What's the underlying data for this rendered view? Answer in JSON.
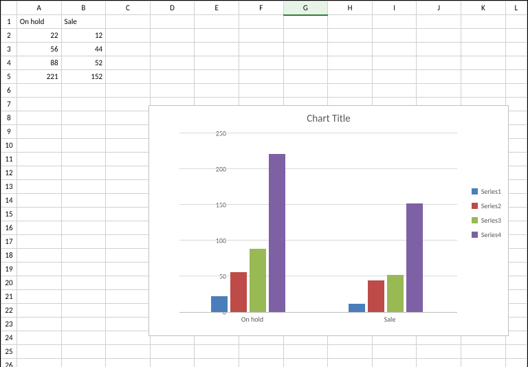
{
  "columns": [
    "A",
    "B",
    "C",
    "D",
    "E",
    "F",
    "G",
    "H",
    "I",
    "J",
    "K",
    "L"
  ],
  "selected_col": "G",
  "rows": 26,
  "sheet": {
    "r1": {
      "A": "On hold",
      "B": "Sale"
    },
    "r2": {
      "A": "22",
      "B": "12"
    },
    "r3": {
      "A": "56",
      "B": "44"
    },
    "r4": {
      "A": "88",
      "B": "52"
    },
    "r5": {
      "A": "221",
      "B": "152"
    }
  },
  "chart_title": "Chart Title",
  "yticks": [
    "0",
    "50",
    "100",
    "150",
    "200",
    "250"
  ],
  "xlabels": {
    "0": "On hold",
    "1": "Sale"
  },
  "legend": {
    "0": "Series1",
    "1": "Series2",
    "2": "Series3",
    "3": "Series4"
  },
  "chart_data": {
    "type": "bar",
    "title": "Chart Title",
    "xlabel": "",
    "ylabel": "",
    "ylim": [
      0,
      250
    ],
    "categories": [
      "On hold",
      "Sale"
    ],
    "series": [
      {
        "name": "Series1",
        "values": [
          22,
          12
        ]
      },
      {
        "name": "Series2",
        "values": [
          56,
          44
        ]
      },
      {
        "name": "Series3",
        "values": [
          88,
          52
        ]
      },
      {
        "name": "Series4",
        "values": [
          221,
          152
        ]
      }
    ],
    "colors": {
      "Series1": "#4a7ebb",
      "Series2": "#be4b48",
      "Series3": "#98b954",
      "Series4": "#7e61a4"
    }
  }
}
